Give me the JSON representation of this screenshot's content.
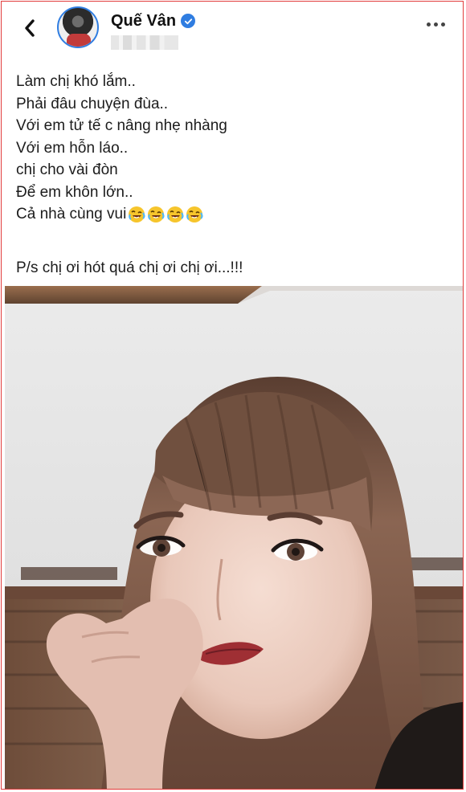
{
  "profile": {
    "name": "Quế Vân",
    "verified": true,
    "subtitle": ""
  },
  "header": {
    "back_icon": "chevron-left-icon",
    "more_icon": "more-horizontal-icon"
  },
  "post": {
    "lines": [
      "Làm chị khó lắm..",
      "Phải đâu chuyện đùa..",
      "Với em tử tế c nâng nhẹ nhàng",
      "Với em hỗn láo..",
      "chị cho vài đòn",
      "Để em khôn lớn.."
    ],
    "emoji_line_text": "Cả nhà cùng vui",
    "emoji_names": [
      "rolling-on-the-floor-laughing-emoji",
      "rolling-on-the-floor-laughing-emoji",
      "rolling-on-the-floor-laughing-emoji",
      "rolling-on-the-floor-laughing-emoji"
    ],
    "ps_text": "P/s chị ơi hót quá chị ơi chị ơi...!!!"
  },
  "photo": {
    "subject": "selfie-photo"
  },
  "colors": {
    "border": "#e23c3c",
    "verified_blue": "#2f7de1",
    "text": "#1c1c1c"
  }
}
